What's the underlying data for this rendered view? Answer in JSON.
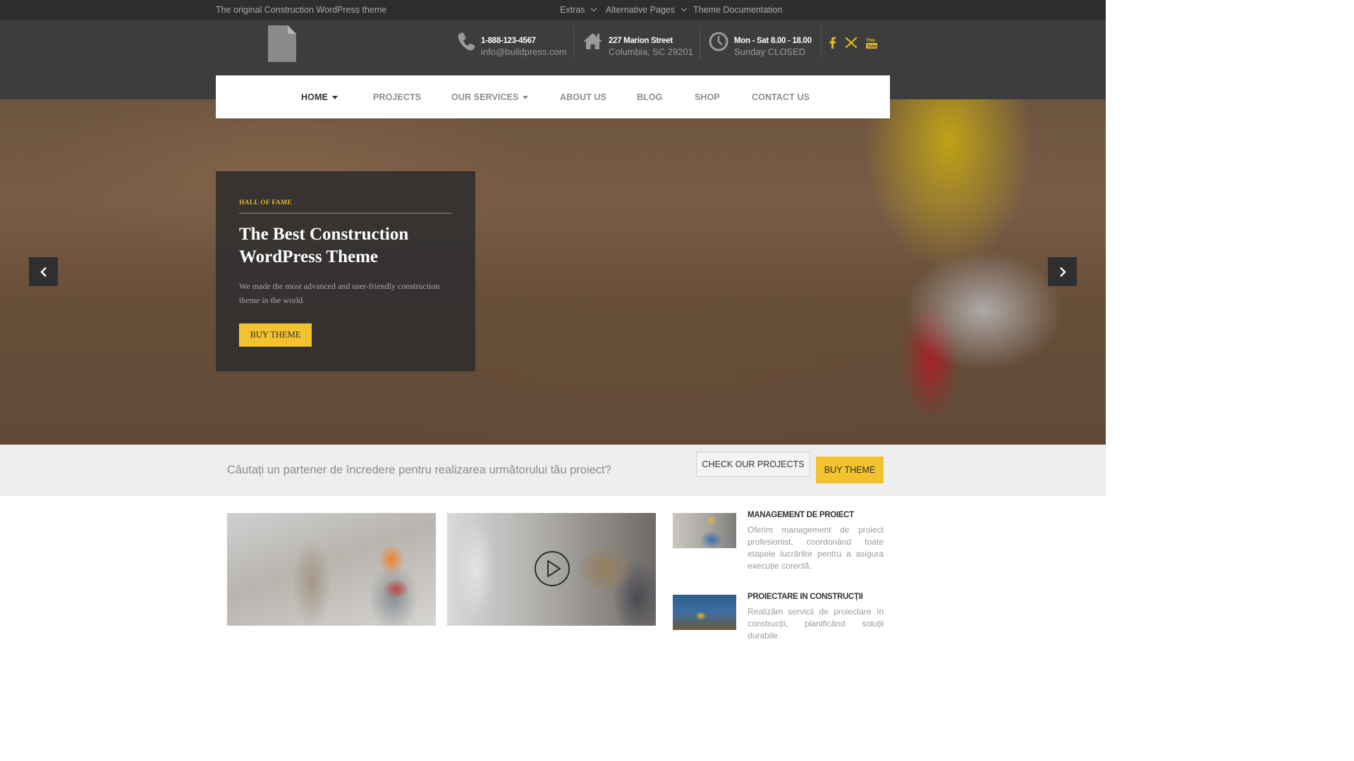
{
  "topbar": {
    "tagline": "The original Construction WordPress theme",
    "menu": [
      {
        "label": "Extras",
        "has_dropdown": true
      },
      {
        "label": "Alternative Pages",
        "has_dropdown": true
      },
      {
        "label": "Theme Documentation",
        "has_dropdown": false
      }
    ]
  },
  "header": {
    "logo_icon": "document-icon",
    "contacts": [
      {
        "icon": "phone-icon",
        "line1": "1-888-123-4567",
        "line2": "info@buildpress.com"
      },
      {
        "icon": "home-icon",
        "line1": "227 Marion Street",
        "line2": "Columbia, SC 29201"
      },
      {
        "icon": "clock-icon",
        "line1": "Mon - Sat 8.00 - 18.00",
        "line2": "Sunday CLOSED"
      }
    ],
    "social": [
      "facebook-icon",
      "x-icon",
      "youtube-icon"
    ],
    "social_color": "#e2b929"
  },
  "nav": {
    "items": [
      {
        "label": "HOME",
        "active": true,
        "has_dropdown": true
      },
      {
        "label": "PROJECTS",
        "active": false,
        "has_dropdown": false
      },
      {
        "label": "OUR SERVICES",
        "active": false,
        "has_dropdown": true
      },
      {
        "label": "ABOUT US",
        "active": false,
        "has_dropdown": false
      },
      {
        "label": "BLOG",
        "active": false,
        "has_dropdown": false
      },
      {
        "label": "SHOP",
        "active": false,
        "has_dropdown": false
      },
      {
        "label": "CONTACT US",
        "active": false,
        "has_dropdown": false
      }
    ]
  },
  "hero": {
    "kicker": "HALL OF FAME",
    "title": "The Best Construction WordPress Theme",
    "description": "We made the most advanced and user-friendly construction theme in the world.",
    "button": "BUY THEME",
    "prev_icon": "chevron-left-icon",
    "next_icon": "chevron-right-icon"
  },
  "callout": {
    "text": "Căutați un partener de încredere pentru realizarea următorului tău proiect?",
    "secondary_button": "CHECK OUR PROJECTS",
    "primary_button": "BUY THEME"
  },
  "services": [
    {
      "title": "MANAGEMENT DE PROIECT",
      "description": "Oferim management de proiect profesionist, coordonând toate etapele lucrărilor pentru a asigura execuție corectă."
    },
    {
      "title": "PROIECTARE IN CONSTRUCȚII",
      "description": "Realizăm servicii de proiectare în construcții, planificând soluții durabile."
    }
  ],
  "colors": {
    "accent": "#f3c32f",
    "topbar": "#2e2e2e",
    "header": "#3d3d3d"
  }
}
